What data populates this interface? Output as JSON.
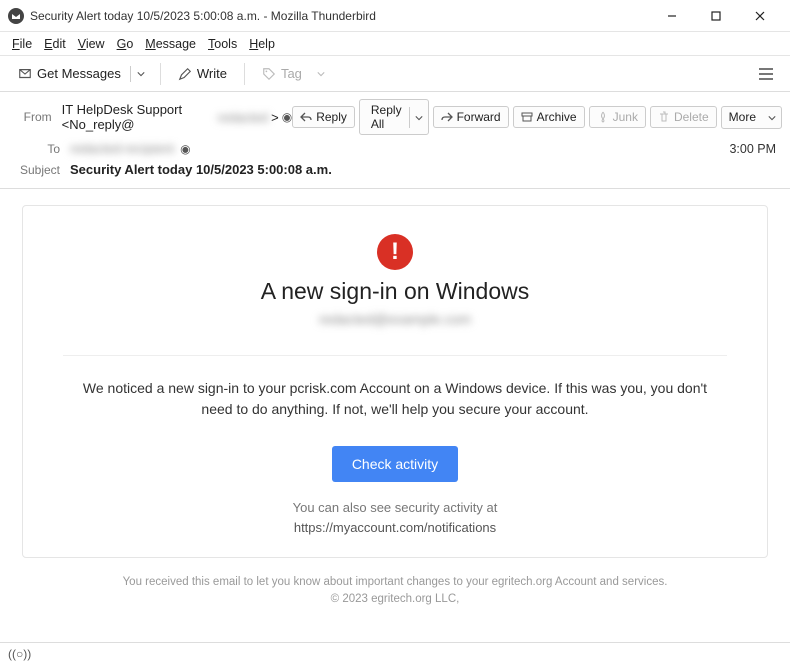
{
  "window": {
    "title": "Security Alert today 10/5/2023 5:00:08 a.m. - Mozilla Thunderbird"
  },
  "menu": {
    "file": "File",
    "edit": "Edit",
    "view": "View",
    "go": "Go",
    "message": "Message",
    "tools": "Tools",
    "help": "Help"
  },
  "toolbar": {
    "get_messages": "Get Messages",
    "write": "Write",
    "tag": "Tag"
  },
  "header": {
    "from_label": "From",
    "from_value": "IT HelpDesk Support <No_reply@",
    "from_redacted": "redacted",
    "from_suffix": ">",
    "to_label": "To",
    "to_value": "redacted-recipient",
    "time": "3:00 PM",
    "subject_label": "Subject",
    "subject_value": "Security Alert today 10/5/2023 5:00:08 a.m."
  },
  "actions": {
    "reply": "Reply",
    "reply_all": "Reply All",
    "forward": "Forward",
    "archive": "Archive",
    "junk": "Junk",
    "delete": "Delete",
    "more": "More"
  },
  "email": {
    "heading": "A new sign-in on Windows",
    "sub_redacted": "redacted@example.com",
    "body": "We noticed a new sign-in to your pcrisk.com Account on a Windows device. If this was you, you don't need to do anything. If not, we'll help you secure your account.",
    "cta": "Check activity",
    "note1": "You can also see security activity at",
    "note2": "https://myaccount.com/notifications",
    "footer1": "You received this email to let you know about important changes to your egritech.org Account and services.",
    "footer2": "© 2023 egritech.org LLC,"
  },
  "status": {
    "icon": "((○))"
  }
}
